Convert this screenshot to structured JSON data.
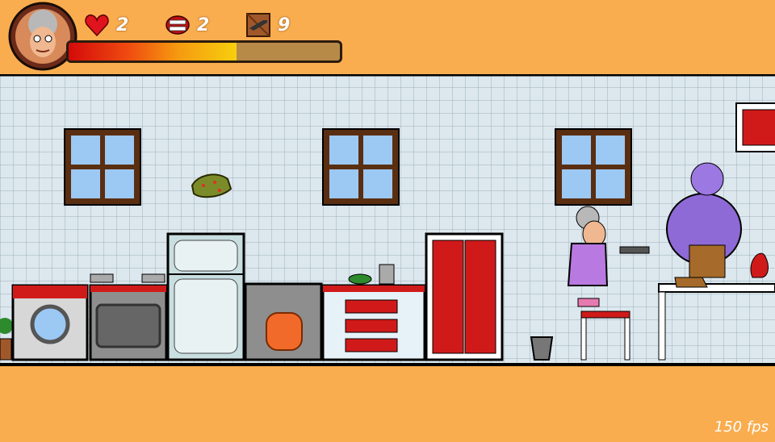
{
  "hud": {
    "lives_icon": "heart-icon",
    "lives_count": "2",
    "dentures_icon": "dentures-icon",
    "dentures_count": "2",
    "ammo_icon": "shotgun-crate-icon",
    "ammo_count": "9",
    "health_fraction": 0.62,
    "avatar": "granny-portrait"
  },
  "scene": {
    "player": "granny-with-pistol",
    "enemy": "purple-zombie",
    "projectile": "green-slime-blob"
  },
  "fps_label": "150 fps",
  "colors": {
    "background": "#F9AD4F",
    "wall_tile": "#D9E6EE",
    "cabinet_red": "#D01A1A",
    "health_red": "#d40a0a",
    "health_yellow": "#f7cf0e"
  }
}
